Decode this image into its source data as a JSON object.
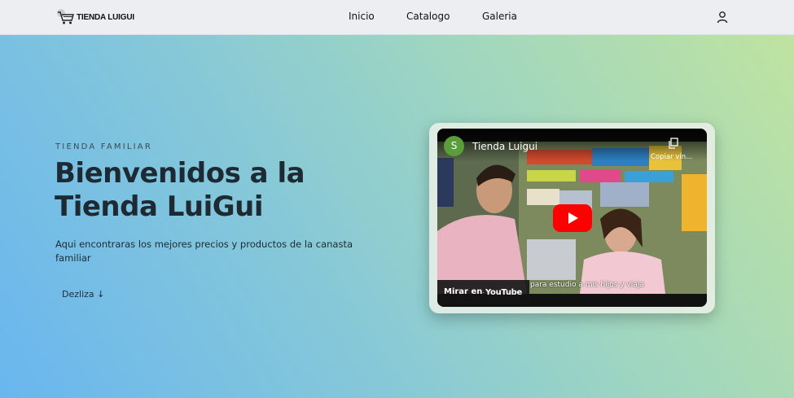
{
  "navbar": {
    "logo_text": "TIENDA LUIGUI",
    "links": [
      "Inicio",
      "Catalogo",
      "Galeria"
    ]
  },
  "hero": {
    "eyebrow": "TIENDA FAMILIAR",
    "title_line1": "Bienvenidos a la",
    "title_line2": "Tienda LuiGui",
    "subtitle": "Aqui encontraras los mejores precios y productos de la canasta familiar",
    "scroll_label": "Dezliza ↓"
  },
  "video": {
    "channel_initial": "S",
    "channel_name": "Tienda Luigui",
    "copy_label": "Copiar vín...",
    "caption": "para estudio a mis hijos y viaja",
    "watch_label": "Mirar en",
    "youtube_word": "YouTube"
  },
  "colors": {
    "play_red": "#ff0000",
    "avatar_green": "#5a9e39"
  },
  "icons": [
    "cart-icon",
    "user-icon",
    "copy-icon",
    "play-icon",
    "youtube-icon"
  ]
}
